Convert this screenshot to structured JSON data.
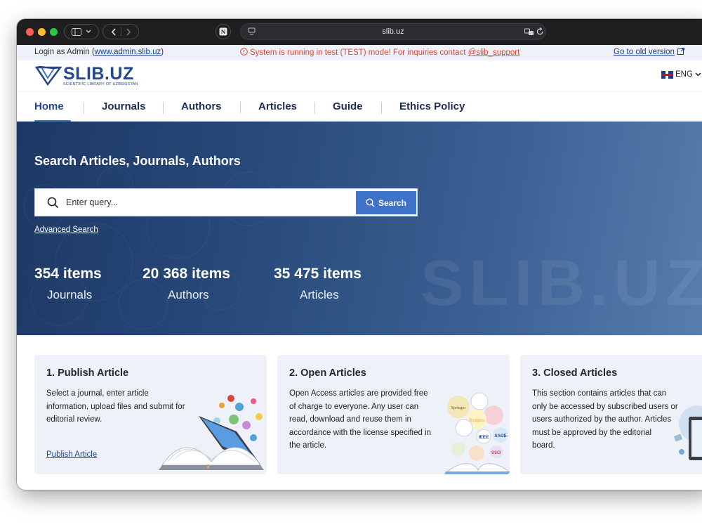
{
  "browser": {
    "url": "slib.uz",
    "buttons": {
      "sidebar": "sidebar-toggle",
      "back": "back",
      "forward": "forward"
    }
  },
  "notice": {
    "login_prefix": "Login as Admin (",
    "login_link": "www.admin.slib.uz",
    "login_suffix": ")",
    "warning_text": "System is running in test (TEST) mode! For inquiries contact ",
    "warning_link": "@slib_support",
    "old_version": "Go to old version"
  },
  "header": {
    "logo": "SLIB.UZ",
    "logo_sub": "SCIENTIFIC LIBRARY OF UZBEKISTAN",
    "language": "ENG"
  },
  "nav": {
    "items": [
      {
        "label": "Home"
      },
      {
        "label": "Journals"
      },
      {
        "label": "Authors"
      },
      {
        "label": "Articles"
      },
      {
        "label": "Guide"
      },
      {
        "label": "Ethics Policy"
      }
    ]
  },
  "hero": {
    "watermark": "SLIB.UZ",
    "title": "Search Articles, Journals, Authors",
    "search_placeholder": "Enter query...",
    "search_button": "Search",
    "advanced_search": "Advanced Search",
    "stats": [
      {
        "value": "354 items",
        "label": "Journals"
      },
      {
        "value": "20 368 items",
        "label": "Authors"
      },
      {
        "value": "35 475 items",
        "label": "Articles"
      }
    ]
  },
  "cards": [
    {
      "title": "1. Publish Article",
      "lines": [
        "Select a journal, enter article",
        "information, upload files and submit for",
        "editorial review."
      ],
      "link": "Publish Article"
    },
    {
      "title": "2. Open Articles",
      "lines": [
        "Open Access articles are provided free",
        "of charge to everyone. Any user can",
        "read, download and reuse them in",
        "accordance with the license specified in",
        "the article."
      ]
    },
    {
      "title": "3. Closed Articles",
      "lines": [
        "This section contains articles that can",
        "only be accessed by subscribed users or",
        "users authorized by the author. Articles",
        "must be approved by the editorial",
        "board."
      ]
    }
  ],
  "illustration_labels": [
    "Springer",
    "Scopus",
    "IEEE",
    "SSCI",
    "SAGE"
  ],
  "colors": {
    "brand": "#24478e",
    "accent": "#3f72c9",
    "warning": "#d9463b",
    "hero_dark": "#1e3864",
    "card_bg": "#eef2f8"
  }
}
